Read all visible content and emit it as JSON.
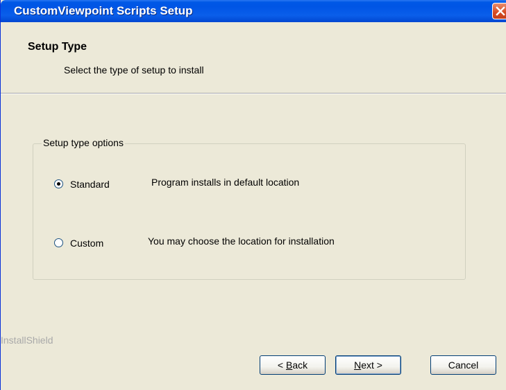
{
  "window": {
    "title": "CustomViewpoint Scripts Setup"
  },
  "header": {
    "title": "Setup Type",
    "subtitle": "Select the type of setup to install"
  },
  "options_group": {
    "label": "Setup type options",
    "selected": "Standard",
    "options": [
      {
        "label": "Standard",
        "description": "Program installs in default location",
        "checked": true
      },
      {
        "label": "Custom",
        "description": "You may choose the location for installation",
        "checked": false
      }
    ]
  },
  "footer": {
    "brand": "InstallShield"
  },
  "buttons": {
    "back": {
      "prefix": "< ",
      "hotkey": "B",
      "rest": "ack"
    },
    "next": {
      "hotkey": "N",
      "rest": "ext >"
    },
    "cancel": "Cancel"
  },
  "colors": {
    "titlebar": "#0055E5",
    "window_bg": "#ECE9D8",
    "close_button": "#D74A22",
    "brand_text": "#A9A9A9"
  },
  "icons": {
    "close": "close-x-icon"
  }
}
